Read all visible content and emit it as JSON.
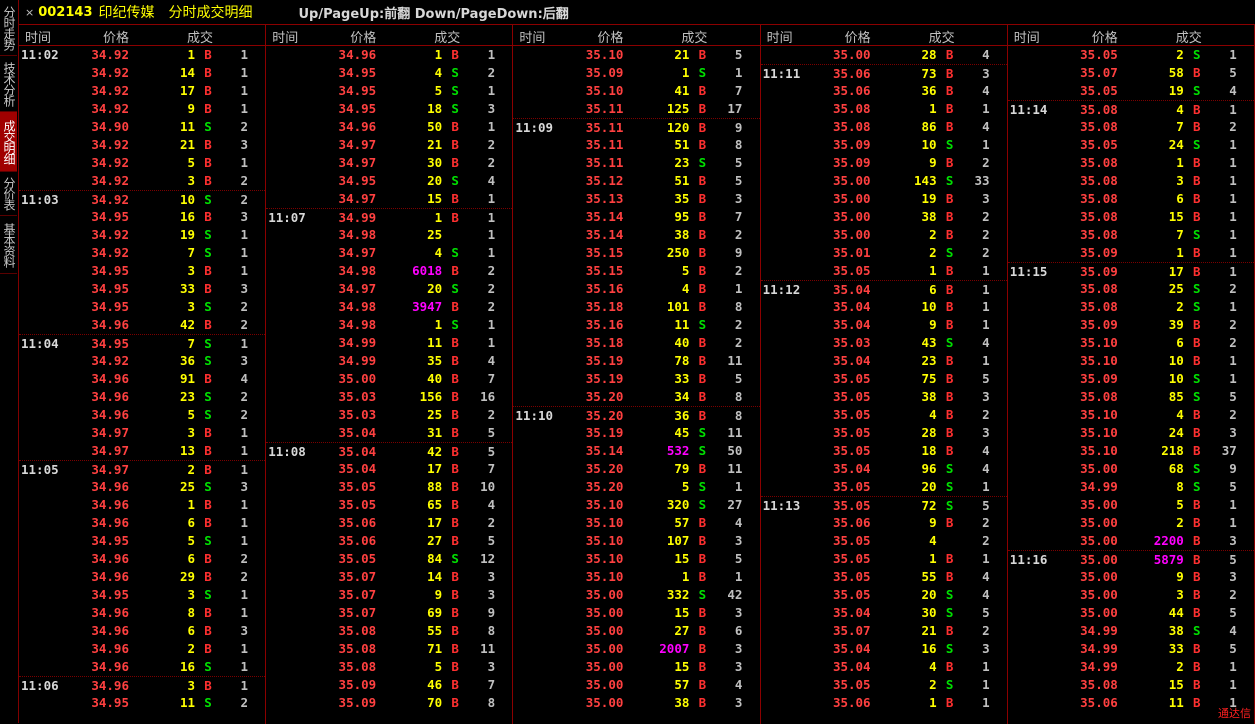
{
  "sidebar": [
    {
      "label": "分时走势",
      "active": false
    },
    {
      "label": "技术分析",
      "active": false
    },
    {
      "label": "成交明细",
      "active": true
    },
    {
      "label": "分价表",
      "active": false
    },
    {
      "label": "基本资料",
      "active": false
    }
  ],
  "title": {
    "close": "×",
    "code": "002143",
    "name": "印纪传媒",
    "mode": "分时成交明细",
    "hint": "Up/PageUp:前翻 Down/PageDown:后翻"
  },
  "headers": {
    "time": "时间",
    "price": "价格",
    "volume": "成交"
  },
  "brand": "通达信",
  "columns": [
    [
      [
        "11:02",
        "34.92",
        "1",
        "B",
        "1"
      ],
      [
        "",
        "34.92",
        "14",
        "B",
        "1"
      ],
      [
        "",
        "34.92",
        "17",
        "B",
        "1"
      ],
      [
        "",
        "34.92",
        "9",
        "B",
        "1"
      ],
      [
        "",
        "34.90",
        "11",
        "S",
        "2"
      ],
      [
        "",
        "34.92",
        "21",
        "B",
        "3"
      ],
      [
        "",
        "34.92",
        "5",
        "B",
        "1"
      ],
      [
        "",
        "34.92",
        "3",
        "B",
        "2"
      ],
      [
        "11:03",
        "34.92",
        "10",
        "S",
        "2"
      ],
      [
        "",
        "34.95",
        "16",
        "B",
        "3"
      ],
      [
        "",
        "34.92",
        "19",
        "S",
        "1"
      ],
      [
        "",
        "34.92",
        "7",
        "S",
        "1"
      ],
      [
        "",
        "34.95",
        "3",
        "B",
        "1"
      ],
      [
        "",
        "34.95",
        "33",
        "B",
        "3"
      ],
      [
        "",
        "34.95",
        "3",
        "S",
        "2"
      ],
      [
        "",
        "34.96",
        "42",
        "B",
        "2"
      ],
      [
        "11:04",
        "34.95",
        "7",
        "S",
        "1"
      ],
      [
        "",
        "34.92",
        "36",
        "S",
        "3"
      ],
      [
        "",
        "34.96",
        "91",
        "B",
        "4"
      ],
      [
        "",
        "34.96",
        "23",
        "S",
        "2"
      ],
      [
        "",
        "34.96",
        "5",
        "S",
        "2"
      ],
      [
        "",
        "34.97",
        "3",
        "B",
        "1"
      ],
      [
        "",
        "34.97",
        "13",
        "B",
        "1"
      ],
      [
        "11:05",
        "34.97",
        "2",
        "B",
        "1"
      ],
      [
        "",
        "34.96",
        "25",
        "S",
        "3"
      ],
      [
        "",
        "34.96",
        "1",
        "B",
        "1"
      ],
      [
        "",
        "34.96",
        "6",
        "B",
        "1"
      ],
      [
        "",
        "34.95",
        "5",
        "S",
        "1"
      ],
      [
        "",
        "34.96",
        "6",
        "B",
        "2"
      ],
      [
        "",
        "34.96",
        "29",
        "B",
        "2"
      ],
      [
        "",
        "34.95",
        "3",
        "S",
        "1"
      ],
      [
        "",
        "34.96",
        "8",
        "B",
        "1"
      ],
      [
        "",
        "34.96",
        "6",
        "B",
        "3"
      ],
      [
        "",
        "34.96",
        "2",
        "B",
        "1"
      ],
      [
        "",
        "34.96",
        "16",
        "S",
        "1"
      ],
      [
        "11:06",
        "34.96",
        "3",
        "B",
        "1"
      ],
      [
        "",
        "34.95",
        "11",
        "S",
        "2"
      ]
    ],
    [
      [
        "",
        "34.96",
        "1",
        "B",
        "1"
      ],
      [
        "",
        "34.95",
        "4",
        "S",
        "2"
      ],
      [
        "",
        "34.95",
        "5",
        "S",
        "1"
      ],
      [
        "",
        "34.95",
        "18",
        "S",
        "3"
      ],
      [
        "",
        "34.96",
        "50",
        "B",
        "1"
      ],
      [
        "",
        "34.97",
        "21",
        "B",
        "2"
      ],
      [
        "",
        "34.97",
        "30",
        "B",
        "2"
      ],
      [
        "",
        "34.95",
        "20",
        "S",
        "4"
      ],
      [
        "",
        "34.97",
        "15",
        "B",
        "1"
      ],
      [
        "11:07",
        "34.99",
        "1",
        "B",
        "1"
      ],
      [
        "",
        "34.98",
        "25",
        "",
        "1"
      ],
      [
        "",
        "34.97",
        "4",
        "S",
        "1"
      ],
      [
        "",
        "34.98",
        "6018",
        "B",
        "2"
      ],
      [
        "",
        "34.97",
        "20",
        "S",
        "2"
      ],
      [
        "",
        "34.98",
        "3947",
        "B",
        "2"
      ],
      [
        "",
        "34.98",
        "1",
        "S",
        "1"
      ],
      [
        "",
        "34.99",
        "11",
        "B",
        "1"
      ],
      [
        "",
        "34.99",
        "35",
        "B",
        "4"
      ],
      [
        "",
        "35.00",
        "40",
        "B",
        "7"
      ],
      [
        "",
        "35.03",
        "156",
        "B",
        "16"
      ],
      [
        "",
        "35.03",
        "25",
        "B",
        "2"
      ],
      [
        "",
        "35.04",
        "31",
        "B",
        "5"
      ],
      [
        "11:08",
        "35.04",
        "42",
        "B",
        "5"
      ],
      [
        "",
        "35.04",
        "17",
        "B",
        "7"
      ],
      [
        "",
        "35.05",
        "88",
        "B",
        "10"
      ],
      [
        "",
        "35.05",
        "65",
        "B",
        "4"
      ],
      [
        "",
        "35.06",
        "17",
        "B",
        "2"
      ],
      [
        "",
        "35.06",
        "27",
        "B",
        "5"
      ],
      [
        "",
        "35.05",
        "84",
        "S",
        "12"
      ],
      [
        "",
        "35.07",
        "14",
        "B",
        "3"
      ],
      [
        "",
        "35.07",
        "9",
        "B",
        "3"
      ],
      [
        "",
        "35.07",
        "69",
        "B",
        "9"
      ],
      [
        "",
        "35.08",
        "55",
        "B",
        "8"
      ],
      [
        "",
        "35.08",
        "71",
        "B",
        "11"
      ],
      [
        "",
        "35.08",
        "5",
        "B",
        "3"
      ],
      [
        "",
        "35.09",
        "46",
        "B",
        "7"
      ],
      [
        "",
        "35.09",
        "70",
        "B",
        "8"
      ]
    ],
    [
      [
        "",
        "35.10",
        "21",
        "B",
        "5"
      ],
      [
        "",
        "35.09",
        "1",
        "S",
        "1"
      ],
      [
        "",
        "35.10",
        "41",
        "B",
        "7"
      ],
      [
        "",
        "35.11",
        "125",
        "B",
        "17"
      ],
      [
        "11:09",
        "35.11",
        "120",
        "B",
        "9"
      ],
      [
        "",
        "35.11",
        "51",
        "B",
        "8"
      ],
      [
        "",
        "35.11",
        "23",
        "S",
        "5"
      ],
      [
        "",
        "35.12",
        "51",
        "B",
        "5"
      ],
      [
        "",
        "35.13",
        "35",
        "B",
        "3"
      ],
      [
        "",
        "35.14",
        "95",
        "B",
        "7"
      ],
      [
        "",
        "35.14",
        "38",
        "B",
        "2"
      ],
      [
        "",
        "35.15",
        "250",
        "B",
        "9"
      ],
      [
        "",
        "35.15",
        "5",
        "B",
        "2"
      ],
      [
        "",
        "35.16",
        "4",
        "B",
        "1"
      ],
      [
        "",
        "35.18",
        "101",
        "B",
        "8"
      ],
      [
        "",
        "35.16",
        "11",
        "S",
        "2"
      ],
      [
        "",
        "35.18",
        "40",
        "B",
        "2"
      ],
      [
        "",
        "35.19",
        "78",
        "B",
        "11"
      ],
      [
        "",
        "35.19",
        "33",
        "B",
        "5"
      ],
      [
        "",
        "35.20",
        "34",
        "B",
        "8"
      ],
      [
        "11:10",
        "35.20",
        "36",
        "B",
        "8"
      ],
      [
        "",
        "35.19",
        "45",
        "S",
        "11"
      ],
      [
        "",
        "35.14",
        "532",
        "S",
        "50"
      ],
      [
        "",
        "35.20",
        "79",
        "B",
        "11"
      ],
      [
        "",
        "35.20",
        "5",
        "S",
        "1"
      ],
      [
        "",
        "35.10",
        "320",
        "S",
        "27"
      ],
      [
        "",
        "35.10",
        "57",
        "B",
        "4"
      ],
      [
        "",
        "35.10",
        "107",
        "B",
        "3"
      ],
      [
        "",
        "35.10",
        "15",
        "B",
        "5"
      ],
      [
        "",
        "35.10",
        "1",
        "B",
        "1"
      ],
      [
        "",
        "35.00",
        "332",
        "S",
        "42"
      ],
      [
        "",
        "35.00",
        "15",
        "B",
        "3"
      ],
      [
        "",
        "35.00",
        "27",
        "B",
        "6"
      ],
      [
        "",
        "35.00",
        "2007",
        "B",
        "3"
      ],
      [
        "",
        "35.00",
        "15",
        "B",
        "3"
      ],
      [
        "",
        "35.00",
        "57",
        "B",
        "4"
      ],
      [
        "",
        "35.00",
        "38",
        "B",
        "3"
      ]
    ],
    [
      [
        "",
        "35.00",
        "28",
        "B",
        "4"
      ],
      [
        "11:11",
        "35.06",
        "73",
        "B",
        "3"
      ],
      [
        "",
        "35.06",
        "36",
        "B",
        "4"
      ],
      [
        "",
        "35.08",
        "1",
        "B",
        "1"
      ],
      [
        "",
        "35.08",
        "86",
        "B",
        "4"
      ],
      [
        "",
        "35.09",
        "10",
        "S",
        "1"
      ],
      [
        "",
        "35.09",
        "9",
        "B",
        "2"
      ],
      [
        "",
        "35.00",
        "143",
        "S",
        "33"
      ],
      [
        "",
        "35.00",
        "19",
        "B",
        "3"
      ],
      [
        "",
        "35.00",
        "38",
        "B",
        "2"
      ],
      [
        "",
        "35.00",
        "2",
        "B",
        "2"
      ],
      [
        "",
        "35.01",
        "2",
        "S",
        "2"
      ],
      [
        "",
        "35.05",
        "1",
        "B",
        "1"
      ],
      [
        "11:12",
        "35.04",
        "6",
        "B",
        "1"
      ],
      [
        "",
        "35.04",
        "10",
        "B",
        "1"
      ],
      [
        "",
        "35.04",
        "9",
        "B",
        "1"
      ],
      [
        "",
        "35.03",
        "43",
        "S",
        "4"
      ],
      [
        "",
        "35.04",
        "23",
        "B",
        "1"
      ],
      [
        "",
        "35.05",
        "75",
        "B",
        "5"
      ],
      [
        "",
        "35.05",
        "38",
        "B",
        "3"
      ],
      [
        "",
        "35.05",
        "4",
        "B",
        "2"
      ],
      [
        "",
        "35.05",
        "28",
        "B",
        "3"
      ],
      [
        "",
        "35.05",
        "18",
        "B",
        "4"
      ],
      [
        "",
        "35.04",
        "96",
        "S",
        "4"
      ],
      [
        "",
        "35.05",
        "20",
        "S",
        "1"
      ],
      [
        "11:13",
        "35.05",
        "72",
        "S",
        "5"
      ],
      [
        "",
        "35.06",
        "9",
        "B",
        "2"
      ],
      [
        "",
        "35.05",
        "4",
        "",
        "2"
      ],
      [
        "",
        "35.05",
        "1",
        "B",
        "1"
      ],
      [
        "",
        "35.05",
        "55",
        "B",
        "4"
      ],
      [
        "",
        "35.05",
        "20",
        "S",
        "4"
      ],
      [
        "",
        "35.04",
        "30",
        "S",
        "5"
      ],
      [
        "",
        "35.07",
        "21",
        "B",
        "2"
      ],
      [
        "",
        "35.04",
        "16",
        "S",
        "3"
      ],
      [
        "",
        "35.04",
        "4",
        "B",
        "1"
      ],
      [
        "",
        "35.05",
        "2",
        "S",
        "1"
      ],
      [
        "",
        "35.06",
        "1",
        "B",
        "1"
      ]
    ],
    [
      [
        "",
        "35.05",
        "2",
        "S",
        "1"
      ],
      [
        "",
        "35.07",
        "58",
        "B",
        "5"
      ],
      [
        "",
        "35.05",
        "19",
        "S",
        "4"
      ],
      [
        "11:14",
        "35.08",
        "4",
        "B",
        "1"
      ],
      [
        "",
        "35.08",
        "7",
        "B",
        "2"
      ],
      [
        "",
        "35.05",
        "24",
        "S",
        "1"
      ],
      [
        "",
        "35.08",
        "1",
        "B",
        "1"
      ],
      [
        "",
        "35.08",
        "3",
        "B",
        "1"
      ],
      [
        "",
        "35.08",
        "6",
        "B",
        "1"
      ],
      [
        "",
        "35.08",
        "15",
        "B",
        "1"
      ],
      [
        "",
        "35.08",
        "7",
        "S",
        "1"
      ],
      [
        "",
        "35.09",
        "1",
        "B",
        "1"
      ],
      [
        "11:15",
        "35.09",
        "17",
        "B",
        "1"
      ],
      [
        "",
        "35.08",
        "25",
        "S",
        "2"
      ],
      [
        "",
        "35.08",
        "2",
        "S",
        "1"
      ],
      [
        "",
        "35.09",
        "39",
        "B",
        "2"
      ],
      [
        "",
        "35.10",
        "6",
        "B",
        "2"
      ],
      [
        "",
        "35.10",
        "10",
        "B",
        "1"
      ],
      [
        "",
        "35.09",
        "10",
        "S",
        "1"
      ],
      [
        "",
        "35.08",
        "85",
        "S",
        "5"
      ],
      [
        "",
        "35.10",
        "4",
        "B",
        "2"
      ],
      [
        "",
        "35.10",
        "24",
        "B",
        "3"
      ],
      [
        "",
        "35.10",
        "218",
        "B",
        "37"
      ],
      [
        "",
        "35.00",
        "68",
        "S",
        "9"
      ],
      [
        "",
        "34.99",
        "8",
        "S",
        "5"
      ],
      [
        "",
        "35.00",
        "5",
        "B",
        "1"
      ],
      [
        "",
        "35.00",
        "2",
        "B",
        "1"
      ],
      [
        "",
        "35.00",
        "2200",
        "B",
        "3"
      ],
      [
        "11:16",
        "35.00",
        "5879",
        "B",
        "5"
      ],
      [
        "",
        "35.00",
        "9",
        "B",
        "3"
      ],
      [
        "",
        "35.00",
        "3",
        "B",
        "2"
      ],
      [
        "",
        "35.00",
        "44",
        "B",
        "5"
      ],
      [
        "",
        "34.99",
        "38",
        "S",
        "4"
      ],
      [
        "",
        "34.99",
        "33",
        "B",
        "5"
      ],
      [
        "",
        "34.99",
        "2",
        "B",
        "1"
      ],
      [
        "",
        "35.08",
        "15",
        "B",
        "1"
      ],
      [
        "",
        "35.06",
        "11",
        "B",
        "1"
      ]
    ]
  ]
}
